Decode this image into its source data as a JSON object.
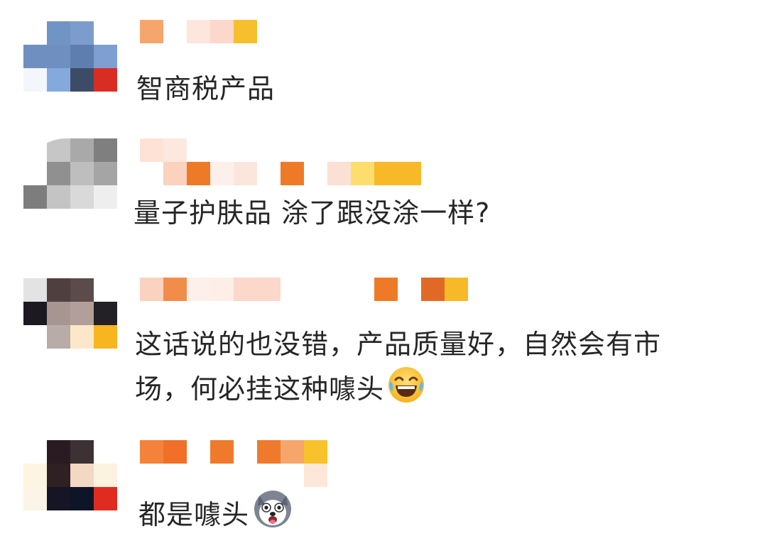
{
  "comments": [
    {
      "text": "智商税产品",
      "emoji": null,
      "avatar_colors": [
        "#ffffff",
        "#7094c3",
        "#7b9ccc",
        "#ffffff",
        "#6e8fc0",
        "#6e8fc0",
        "#5d7eae",
        "#7f9fd3",
        "#f3f6fb",
        "#84a9dc",
        "#3d4c66",
        "#d92d24"
      ],
      "name_colors": [
        [
          "#f6a56c",
          "#ffffff",
          "#fde6dc",
          "#fbd8cb",
          "#f7bf2e"
        ],
        [
          "#ffffff",
          "#ffffff",
          "#ffffff",
          "#ffffff",
          "#ffffff"
        ]
      ]
    },
    {
      "text": "量子护肤品  涂了跟没涂一样?",
      "emoji": null,
      "avatar_colors": [
        "#ffffff",
        "#c6c6c6",
        "#a9a9a9",
        "#7f7f7f",
        "#ffffff",
        "#909090",
        "#bebebe",
        "#a5a5a5",
        "#7d7d7d",
        "#c4c4c4",
        "#d9d9d9",
        "#eeeeee"
      ],
      "name_colors": [
        [
          "#fde2d5",
          "#fde8df",
          "#ffffff",
          "#ffffff",
          "#ffffff",
          "#ffffff",
          "#ffffff",
          "#ffffff",
          "#ffffff",
          "#ffffff",
          "#ffffff",
          "#ffffff"
        ],
        [
          "#ffffff",
          "#fbd2bd",
          "#ee7a28",
          "#fdf0ea",
          "#fbe6dc",
          "#ffffff",
          "#ee7a28",
          "#ffffff",
          "#fbe0d4",
          "#fddd6e",
          "#f8b928",
          "#f8b928"
        ]
      ]
    },
    {
      "text": "这话说的也没错，产品质量好，自然会有市场，何必挂这种噱头",
      "line1": "这话说的也没错，产品质量好，自然会有市",
      "line2": "场，何必挂这种噱头",
      "emoji": "laughing",
      "avatar_colors": [
        "#e3e3e3",
        "#4f3f3e",
        "#5b4b4a",
        "#ffffff",
        "#1c1a20",
        "#a79591",
        "#b39f99",
        "#232125",
        "#ffffff",
        "#b8aba8",
        "#fce7c8",
        "#f7b51f"
      ],
      "name_colors": [
        [
          "#fbd2bf",
          "#f28c4b",
          "#fdf0eb",
          "#fdefe7",
          "#fbd8c9",
          "#fbd8c9",
          "#ffffff",
          "#ffffff",
          "#ffffff",
          "#ffffff",
          "#ee7a28",
          "#ffffff",
          "#e06a25",
          "#f8b928"
        ]
      ]
    },
    {
      "text": "都是噱头",
      "emoji": "dog",
      "avatar_colors": [
        "#ffffff",
        "#2a1b23",
        "#3c3233",
        "#ffffff",
        "#fdf4e1",
        "#2f2023",
        "#f3d8c4",
        "#fbf2df",
        "#fbf4e7",
        "#151525",
        "#0f1529",
        "#e02b20"
      ],
      "name_colors": [
        [
          "#f4823a",
          "#f07028",
          "#ffffff",
          "#f07a2c",
          "#ffffff",
          "#f07a2c",
          "#f6a56b",
          "#f8c22c"
        ],
        [
          "#ffffff",
          "#ffffff",
          "#ffffff",
          "#ffffff",
          "#ffffff",
          "#ffffff",
          "#ffffff",
          "#fde7d9"
        ]
      ]
    }
  ]
}
